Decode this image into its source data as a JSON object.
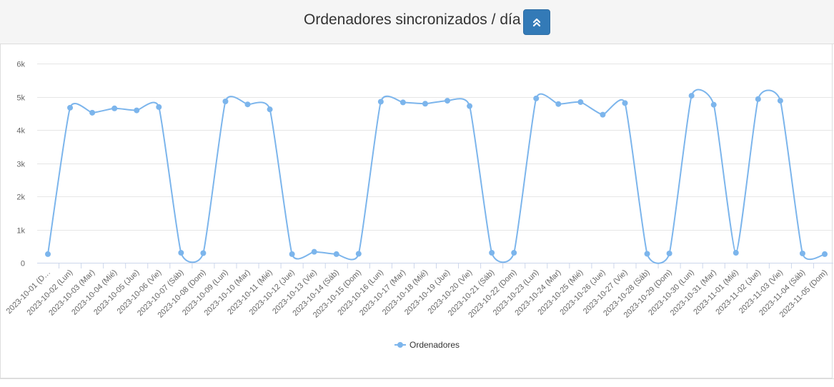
{
  "panel": {
    "title": "Ordenadores sincronizados / día"
  },
  "icons": {
    "collapse": "double-chevron-up-icon"
  },
  "colors": {
    "series": "#7cb5ec",
    "button": "#337ab7"
  },
  "chart_data": {
    "type": "line",
    "smooth": true,
    "title": "",
    "xlabel": "",
    "ylabel": "",
    "ylim": [
      0,
      6000
    ],
    "yticks": [
      0,
      1000,
      2000,
      3000,
      4000,
      5000,
      6000
    ],
    "ytick_labels": [
      "0",
      "1k",
      "2k",
      "3k",
      "4k",
      "5k",
      "6k"
    ],
    "grid": true,
    "legend": "bottom-center",
    "categories": [
      "2023-10-01 (D…",
      "2023-10-02 (Lun)",
      "2023-10-03 (Mar)",
      "2023-10-04 (Mié)",
      "2023-10-05 (Jue)",
      "2023-10-06 (Vie)",
      "2023-10-07 (Sáb)",
      "2023-10-08 (Dom)",
      "2023-10-09 (Lun)",
      "2023-10-10 (Mar)",
      "2023-10-11 (Mié)",
      "2023-10-12 (Jue)",
      "2023-10-13 (Vie)",
      "2023-10-14 (Sáb)",
      "2023-10-15 (Dom)",
      "2023-10-16 (Lun)",
      "2023-10-17 (Mar)",
      "2023-10-18 (Mié)",
      "2023-10-19 (Jue)",
      "2023-10-20 (Vie)",
      "2023-10-21 (Sáb)",
      "2023-10-22 (Dom)",
      "2023-10-23 (Lun)",
      "2023-10-24 (Mar)",
      "2023-10-25 (Mié)",
      "2023-10-26 (Jue)",
      "2023-10-27 (Vie)",
      "2023-10-28 (Sáb)",
      "2023-10-29 (Dom)",
      "2023-10-30 (Lun)",
      "2023-10-31 (Mar)",
      "2023-11-01 (Mié)",
      "2023-11-02 (Jue)",
      "2023-11-03 (Vie)",
      "2023-11-04 (Sáb)",
      "2023-11-05 (Dom)"
    ],
    "series": [
      {
        "name": "Ordenadores",
        "values": [
          260,
          4670,
          4520,
          4650,
          4590,
          4690,
          300,
          290,
          4860,
          4770,
          4620,
          260,
          330,
          260,
          270,
          4850,
          4830,
          4790,
          4880,
          4720,
          300,
          300,
          4950,
          4780,
          4840,
          4460,
          4810,
          270,
          280,
          5030,
          4760,
          300,
          4930,
          4880,
          280,
          260
        ]
      }
    ]
  }
}
